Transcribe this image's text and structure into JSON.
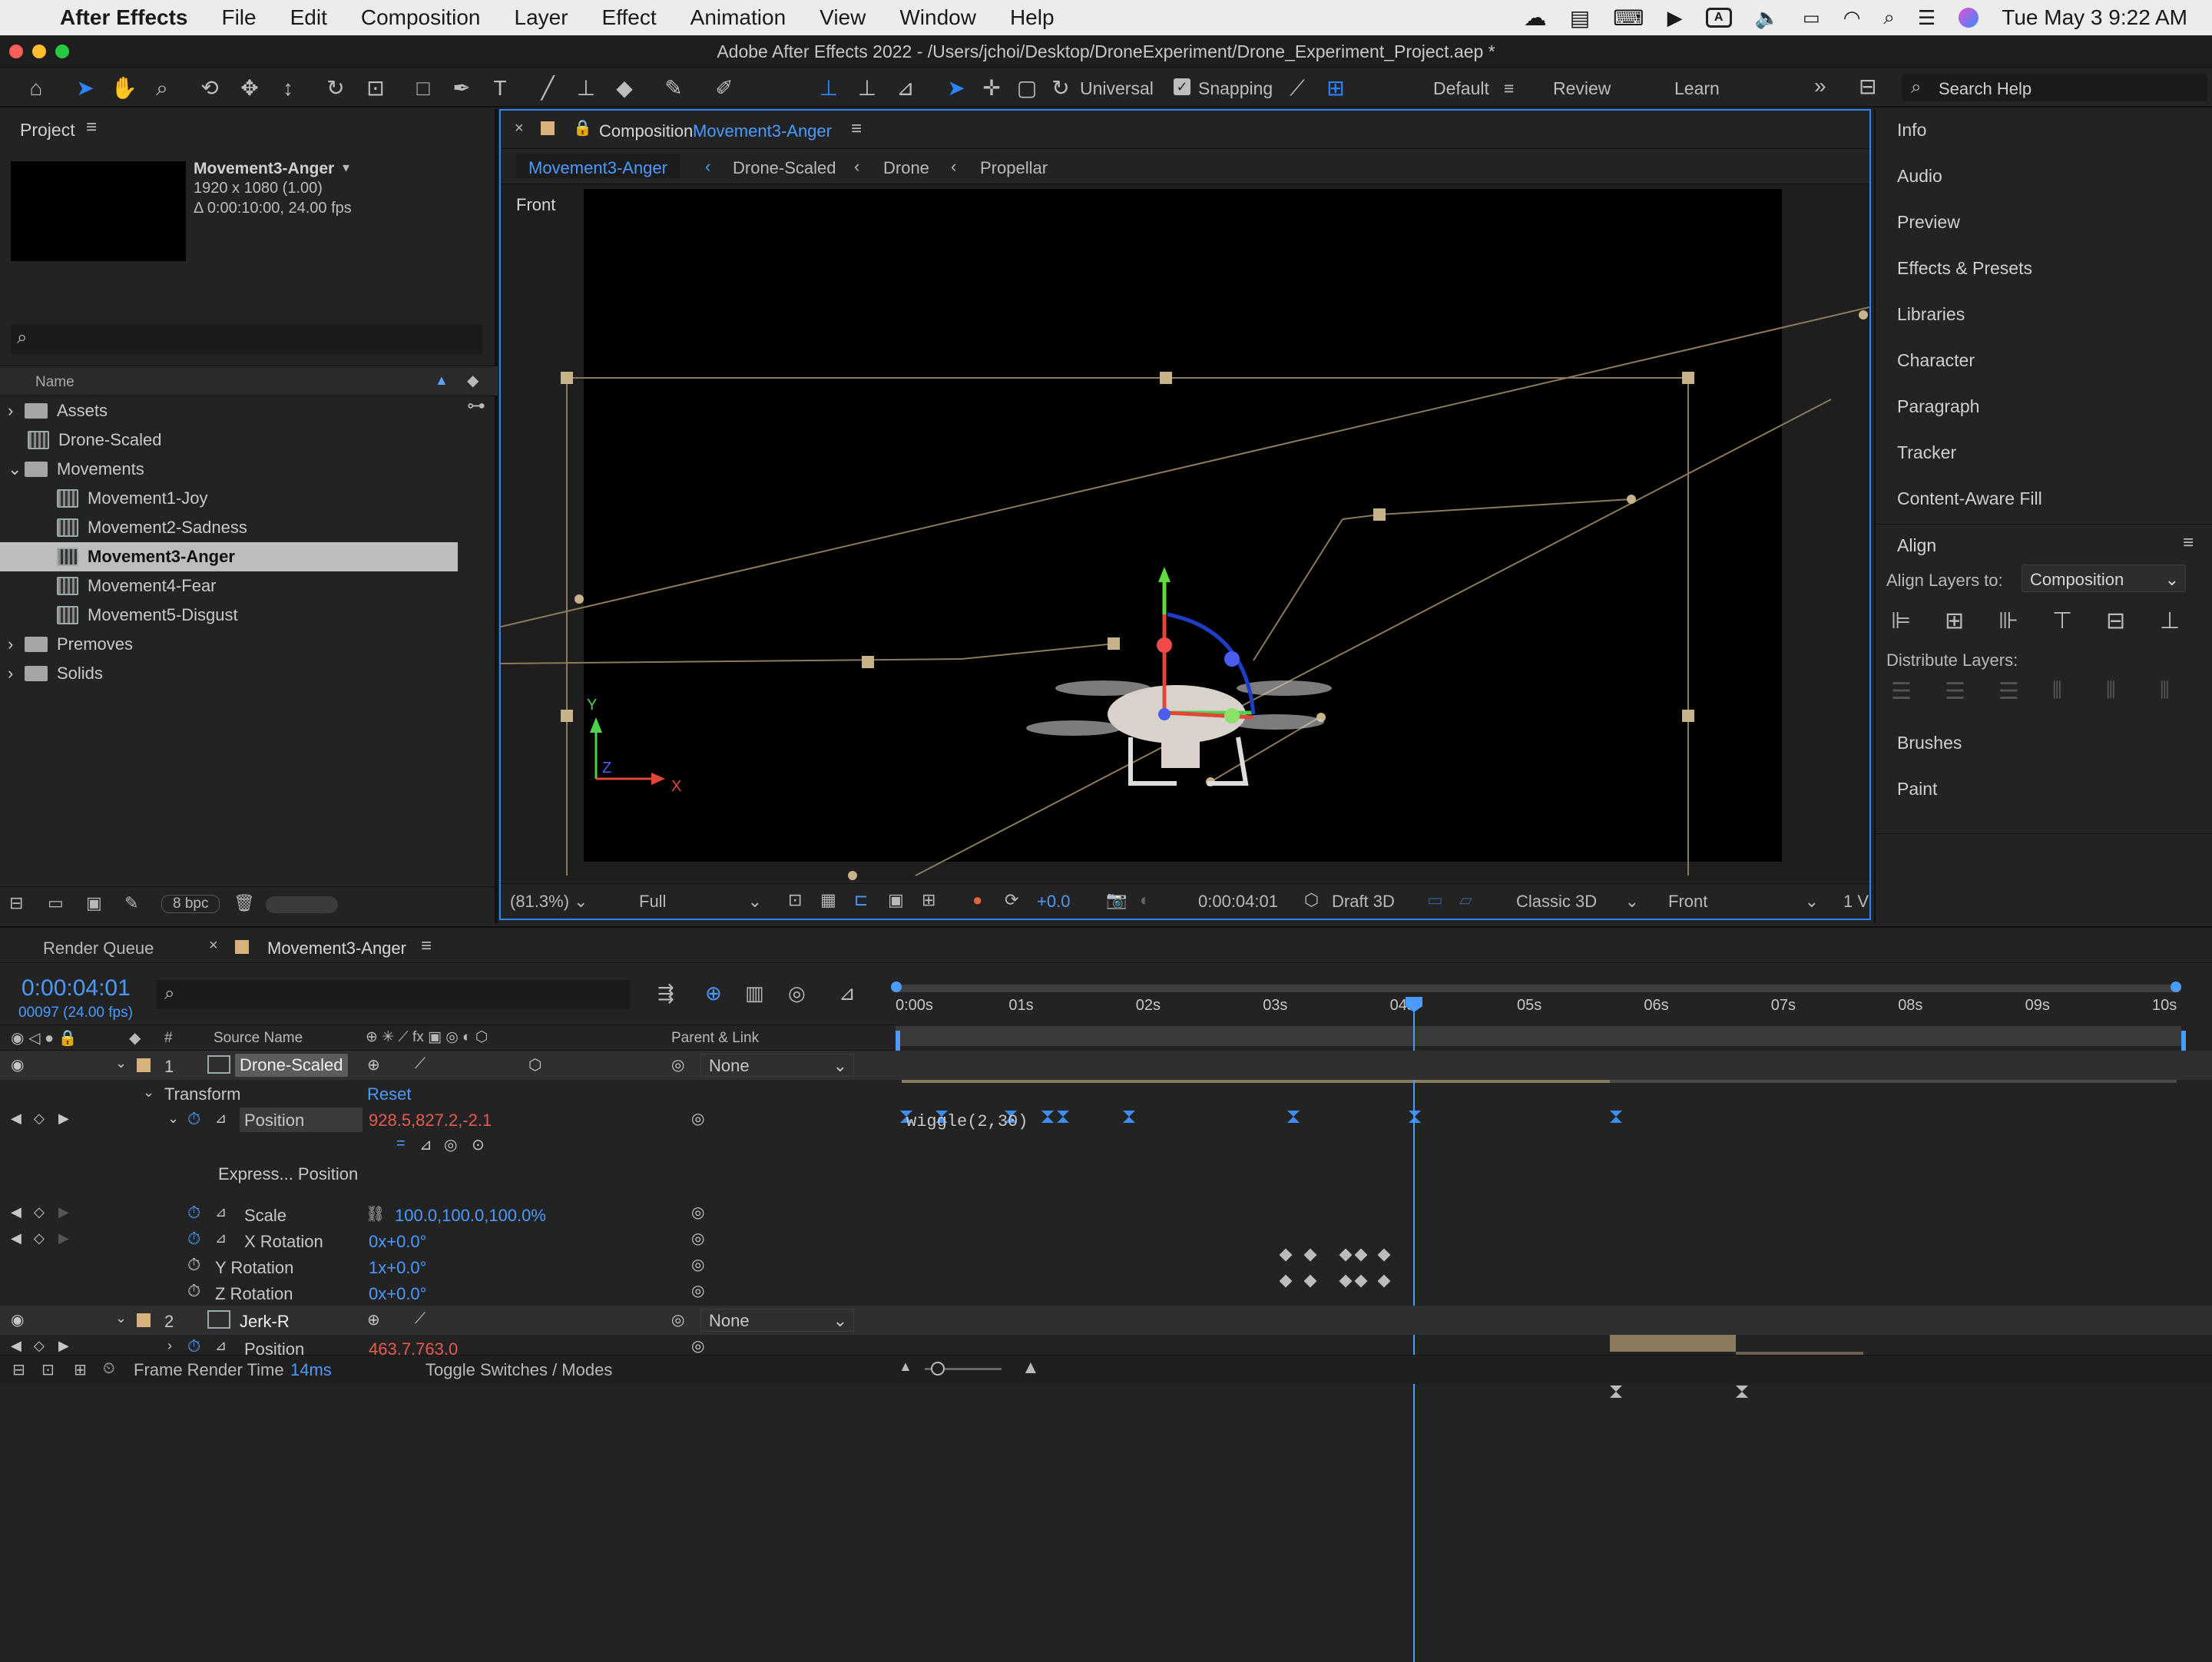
{
  "menubar": {
    "app": "After Effects",
    "items": [
      "File",
      "Edit",
      "Composition",
      "Layer",
      "Effect",
      "Animation",
      "View",
      "Window",
      "Help"
    ],
    "clock": "Tue May 3  9:22 AM"
  },
  "titlebar": {
    "title": "Adobe After Effects 2022 - /Users/jchoi/Desktop/DroneExperiment/Drone_Experiment_Project.aep *"
  },
  "toolbar": {
    "universal": "Universal",
    "snapping": "Snapping",
    "workspaces": [
      "Default",
      "Review",
      "Learn"
    ],
    "search_placeholder": "Search Help"
  },
  "project": {
    "title": "Project",
    "selected_name": "Movement3-Anger",
    "info_size": "1920 x 1080 (1.00)",
    "info_duration": "Δ 0:00:10:00, 24.00 fps",
    "col_name": "Name",
    "bpc": "8 bpc",
    "items": [
      {
        "label": "Assets",
        "type": "folder"
      },
      {
        "label": "Drone-Scaled",
        "type": "comp"
      },
      {
        "label": "Movements",
        "type": "folder"
      },
      {
        "label": "Movement1-Joy",
        "type": "comp"
      },
      {
        "label": "Movement2-Sadness",
        "type": "comp"
      },
      {
        "label": "Movement3-Anger",
        "type": "comp"
      },
      {
        "label": "Movement4-Fear",
        "type": "comp"
      },
      {
        "label": "Movement5-Disgust",
        "type": "comp"
      },
      {
        "label": "Premoves",
        "type": "folder"
      },
      {
        "label": "Solids",
        "type": "folder"
      }
    ]
  },
  "composition": {
    "tab_prefix": "Composition",
    "tab_name": "Movement3-Anger",
    "breadcrumbs": [
      "Movement3-Anger",
      "Drone-Scaled",
      "Drone",
      "Propellar"
    ],
    "view_label": "Front",
    "footer": {
      "zoom": "(81.3%)",
      "resolution": "Full",
      "exposure": "+0.0",
      "timecode": "0:00:04:01",
      "draft": "Draft 3D",
      "renderer": "Classic 3D",
      "view": "Front",
      "views": "1 V"
    }
  },
  "right_panel": {
    "items": [
      "Info",
      "Audio",
      "Preview",
      "Effects & Presets",
      "Libraries",
      "Character",
      "Paragraph",
      "Tracker",
      "Content-Aware Fill"
    ],
    "align_title": "Align",
    "align_to_label": "Align Layers to:",
    "align_to_value": "Composition",
    "distribute_label": "Distribute Layers:",
    "bottom": [
      "Brushes",
      "Paint"
    ]
  },
  "timeline": {
    "tabs": [
      "Render Queue",
      "Movement3-Anger"
    ],
    "timecode": "0:00:04:01",
    "frame_info": "00097 (24.00 fps)",
    "col_source": "Source Name",
    "col_parent": "Parent & Link",
    "col_num": "#",
    "ruler": [
      "0:00s",
      "01s",
      "02s",
      "03s",
      "04s",
      "05s",
      "06s",
      "07s",
      "08s",
      "09s",
      "10s"
    ],
    "layer1": {
      "num": "1",
      "name": "Drone-Scaled",
      "parent": "None"
    },
    "transform": "Transform",
    "reset": "Reset",
    "position": {
      "label": "Position",
      "value": "928.5,827.2,-2.1"
    },
    "expression": {
      "label": "Express... Position",
      "code": "wiggle(2,30)"
    },
    "scale": {
      "label": "Scale",
      "value": "100.0,100.0,100.0%"
    },
    "xrot": {
      "label": "X Rotation",
      "value": "0x+0.0°"
    },
    "yrot": {
      "label": "Y Rotation",
      "value": "1x+0.0°"
    },
    "zrot": {
      "label": "Z Rotation",
      "value": "0x+0.0°"
    },
    "layer2": {
      "num": "2",
      "name": "Jerk-R",
      "parent": "None"
    },
    "position2": {
      "label": "Position",
      "value": "463.7,763.0"
    },
    "footer": {
      "frame_render": "Frame Render Time",
      "frame_ms": "14ms",
      "toggle": "Toggle Switches / Modes"
    }
  }
}
